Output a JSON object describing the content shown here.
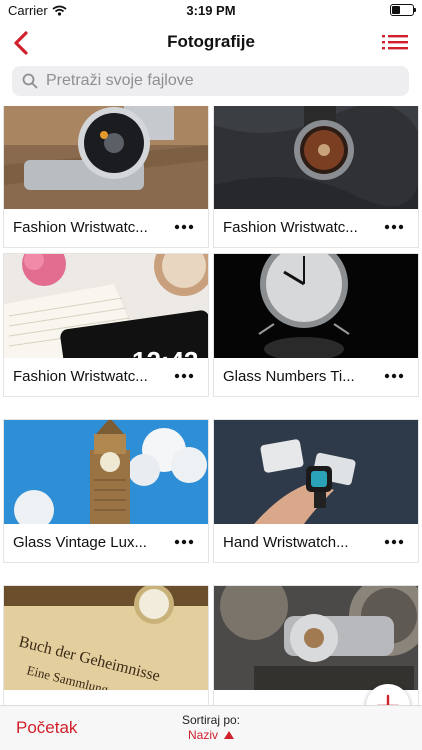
{
  "status_bar": {
    "carrier": "Carrier",
    "time": "3:19 PM"
  },
  "nav": {
    "title": "Fotografije",
    "back_icon": "chevron-left-icon",
    "menu_icon": "list-icon"
  },
  "search": {
    "placeholder": "Pretraži svoje fajlove"
  },
  "files": [
    {
      "name": "Fashion Wristwatc..."
    },
    {
      "name": "Fashion Wristwatc..."
    },
    {
      "name": "Fashion Wristwatc..."
    },
    {
      "name": "Glass Numbers Ti..."
    },
    {
      "name": "Glass Vintage Lux..."
    },
    {
      "name": "Hand Wristwatch..."
    },
    {
      "name": ""
    },
    {
      "name": ""
    }
  ],
  "bottom_bar": {
    "start_label": "Početak",
    "sort_label": "Sortiraj po:",
    "sort_value": "Naziv"
  },
  "colors": {
    "accent": "#d0202b"
  }
}
